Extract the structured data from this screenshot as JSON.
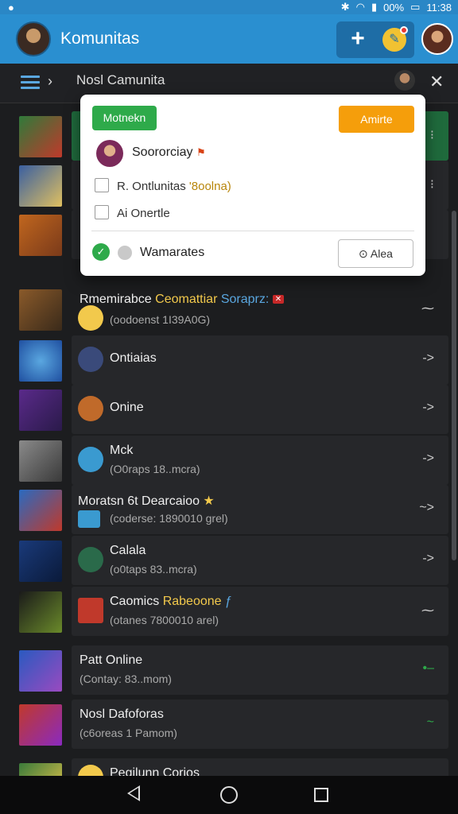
{
  "status_bar": {
    "left_icon": "notification-icon",
    "battery_text": "00%",
    "time": "11:38",
    "icons": [
      "bluetooth-icon",
      "wifi-icon",
      "signal-icon",
      "battery-icon"
    ]
  },
  "app_bar": {
    "title": "Komunitas",
    "add_icon": "+",
    "chat_icon": "chat-bubble-icon"
  },
  "sub_bar": {
    "title": "Nosl Camunita",
    "menu_icon": "hamburger-menu-icon",
    "chevron": "›",
    "close": "✕"
  },
  "popup": {
    "green_button": "Motnekn",
    "orange_button": "Amirte",
    "user_name": "Soororciay",
    "checkbox_items": [
      {
        "label": "R. Ontlunitas",
        "badge": "'8oolna)"
      },
      {
        "label": "Ai Onertle"
      }
    ],
    "bottom_label": "Wamarates",
    "bottom_button": "Alea"
  },
  "list": [
    {
      "name": "",
      "sub": "",
      "arrow": "⁝",
      "colors": [
        "#2f7a3a",
        "#c0392b"
      ],
      "highlight": true
    },
    {
      "name": "",
      "sub": "",
      "arrow": "⁝",
      "colors": [
        "#3a5fa0",
        "#e0c060"
      ]
    },
    {
      "name": "",
      "sub": "",
      "arrow": "",
      "colors": [
        "#c0661e",
        "#7a3a1a"
      ]
    },
    {
      "name_parts": [
        "Rmemirabce ",
        "Ceomattiar",
        " Soraprz:"
      ],
      "sub": "(oodoenst 1I39A0G)",
      "arrow": "⁓",
      "colors": [
        "#8a5a2a",
        "#f2c94c"
      ]
    },
    {
      "name": "Ontiaias",
      "sub": "",
      "arrow": "->",
      "colors": [
        "#1f4fa0",
        "#5aa7e0"
      ]
    },
    {
      "name": "Onine",
      "sub": "",
      "arrow": "->",
      "colors": [
        "#5a2a8a",
        "#c06a2a"
      ]
    },
    {
      "name": "Mck",
      "sub": "(O0raps 18..mcra)",
      "arrow": "->",
      "colors": [
        "#6a6a6a",
        "#3a9ad0"
      ]
    },
    {
      "name": "Moratsn 6t Dearcaioo",
      "sub": "(coderse: 1890010 grel)",
      "arrow": "~>",
      "colors": [
        "#2a6ac0",
        "#c0392b"
      ]
    },
    {
      "name": "Calala",
      "sub": "(o0taps 83..mcra)",
      "arrow": "->",
      "colors": [
        "#1a3a7a",
        "#2a6a4a"
      ]
    },
    {
      "name_parts": [
        "Caomics ",
        "Rabeoone"
      ],
      "sub": "(otanes 7800010 arel)",
      "arrow": "⁓",
      "colors": [
        "#6a8a2a",
        "#c0392b"
      ]
    },
    {
      "name": "Patt Online",
      "sub": "(Contay: 83..mom)",
      "arrow": "•–",
      "colors": [
        "#2a5ac0",
        "#9a4ac0"
      ]
    },
    {
      "name": "Nosl Dafoforas",
      "sub": "(c6oreas 1 Pamom)",
      "arrow": "~",
      "colors": [
        "#c0392b",
        "#8a2ac0"
      ]
    },
    {
      "name": "Pegilunn Corios",
      "sub": "",
      "arrow": "",
      "colors": [
        "#3a7a3a",
        "#f2c94c"
      ]
    }
  ],
  "nav_bar": {
    "back": "back-triangle-icon",
    "home": "home-circle-icon",
    "recent": "recent-square-icon"
  }
}
